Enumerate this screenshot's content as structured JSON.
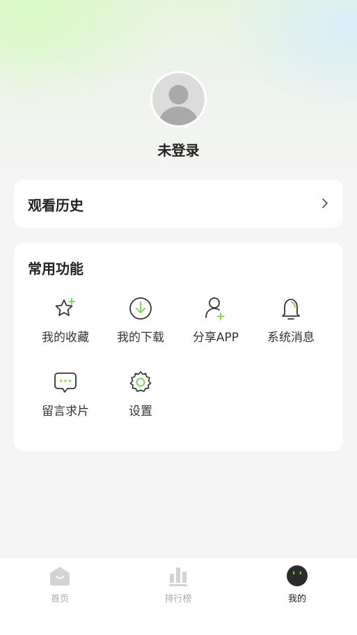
{
  "profile": {
    "username": "未登录"
  },
  "history": {
    "title": "观看历史"
  },
  "functions": {
    "title": "常用功能",
    "items": [
      {
        "label": "我的收藏",
        "icon": "star-plus-icon"
      },
      {
        "label": "我的下载",
        "icon": "download-icon"
      },
      {
        "label": "分享APP",
        "icon": "user-plus-icon"
      },
      {
        "label": "系统消息",
        "icon": "bell-icon"
      },
      {
        "label": "留言求片",
        "icon": "message-icon"
      },
      {
        "label": "设置",
        "icon": "gear-icon"
      }
    ]
  },
  "tabbar": {
    "tabs": [
      {
        "label": "首页",
        "icon": "home-icon"
      },
      {
        "label": "排行榜",
        "icon": "ranking-icon"
      },
      {
        "label": "我的",
        "icon": "profile-face-icon",
        "active": true
      }
    ]
  },
  "colors": {
    "accent": "#7ed957",
    "icon_stroke": "#333333",
    "inactive": "#c8c8c8"
  }
}
